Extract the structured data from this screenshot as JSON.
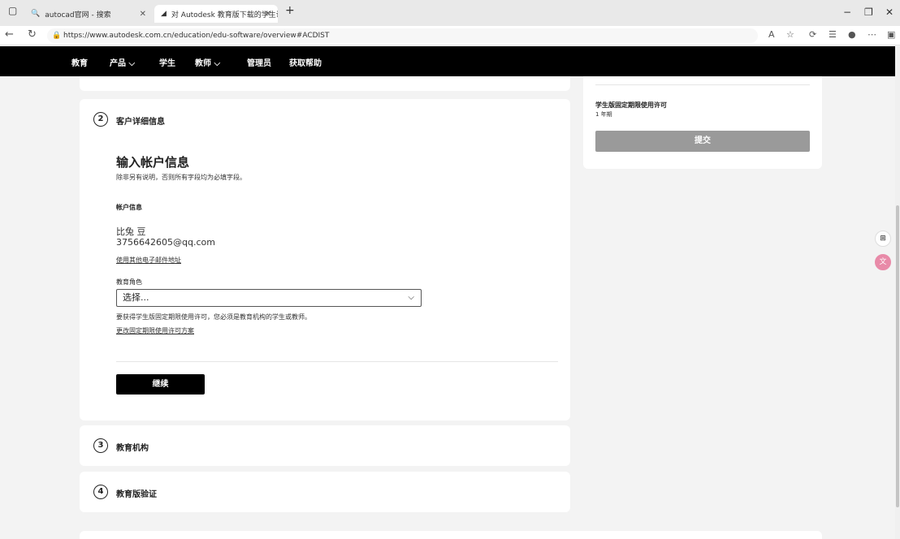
{
  "browser": {
    "tabs": [
      {
        "title": "autocad官网 - 搜索",
        "active": false
      },
      {
        "title": "对 Autodesk 教育版下载的学生访",
        "active": true
      }
    ],
    "new_tab": "+",
    "controls": {
      "minimize": "−",
      "restore": "❐",
      "close": "✕"
    },
    "url": "https://www.autodesk.com.cn/education/edu-software/overview#ACDIST"
  },
  "sitenav": {
    "items": [
      "教育",
      "产品 ⌵",
      "学生",
      "教师 ⌵",
      "管理员",
      "获取帮助"
    ]
  },
  "steps": {
    "step2": {
      "number": "2",
      "title": "客户详细信息"
    },
    "step3": {
      "number": "3",
      "title": "教育机构"
    },
    "step4": {
      "number": "4",
      "title": "教育版验证"
    }
  },
  "account": {
    "heading": "输入帐户信息",
    "subheading": "除非另有说明，否则所有字段均为必填字段。",
    "section_label": "帐户信息",
    "name": "比兔 豆",
    "email": "3756642605@qq.com",
    "use_other_email": "使用其他电子邮件地址",
    "role_label": "教育角色",
    "role_placeholder": "选择...",
    "role_note": "要获得学生版固定期限使用许可，您必须是教育机构的学生或教师。",
    "change_plan": "更改固定期限使用许可方案",
    "continue_label": "继续"
  },
  "summary": {
    "license_title": "学生版固定期限使用许可",
    "term": "1 年期",
    "submit_label": "提交"
  }
}
